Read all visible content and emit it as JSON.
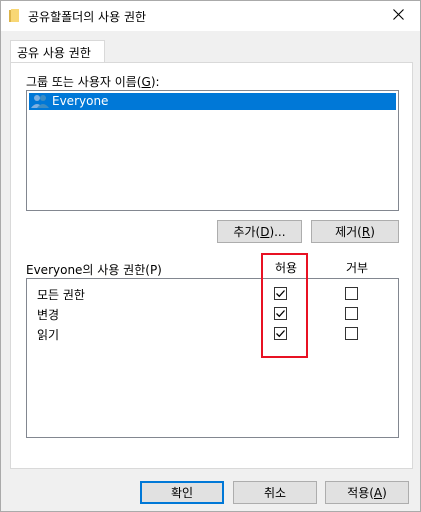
{
  "window": {
    "title": "공유할폴더의 사용 권한"
  },
  "tab": {
    "label": "공유 사용 권한"
  },
  "groups": {
    "label": "그룹 또는 사용자 이름(G):",
    "items": [
      {
        "name": "Everyone",
        "selected": true
      }
    ]
  },
  "buttons": {
    "add": "추가(D)...",
    "remove": "제거(R)",
    "ok": "확인",
    "cancel": "취소",
    "apply": "적용(A)"
  },
  "permissions": {
    "label": "Everyone의 사용 권한(P)",
    "allow_header": "허용",
    "deny_header": "거부",
    "rows": [
      {
        "name": "모든 권한",
        "allow": true,
        "deny": false
      },
      {
        "name": "변경",
        "allow": true,
        "deny": false
      },
      {
        "name": "읽기",
        "allow": true,
        "deny": false
      }
    ]
  },
  "colors": {
    "selection": "#0078d7",
    "highlight_frame": "#e81123",
    "folder_icon": "#f8d775"
  }
}
